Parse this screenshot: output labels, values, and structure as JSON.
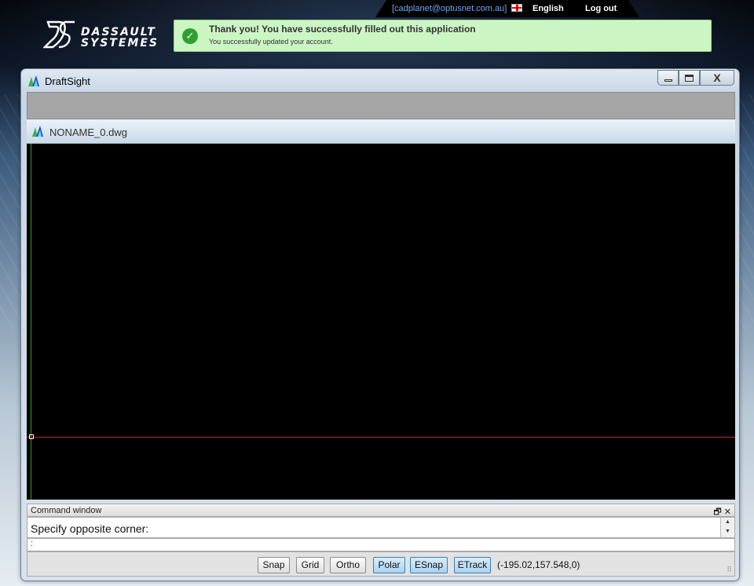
{
  "topbar": {
    "email": "[cadplanet@optusnet.com.au]",
    "language": "English",
    "logout": "Log out"
  },
  "brand": {
    "line1": "DASSAULT",
    "line2": "SYSTEMES"
  },
  "notice": {
    "title": "Thank you! You have successfully filled out this application",
    "subtitle": "You successfully updated your account.",
    "color": "#ccf5c4"
  },
  "window": {
    "title": "DraftSight",
    "close_label": "X"
  },
  "document": {
    "tab_name": "NONAME_0.dwg"
  },
  "command": {
    "header": "Command window",
    "header_icons": "🗗 ✕",
    "output": "Specify opposite corner:",
    "input_prompt": ":"
  },
  "statusbar": {
    "buttons": [
      {
        "label": "Snap",
        "active": false
      },
      {
        "label": "Grid",
        "active": false
      },
      {
        "label": "Ortho",
        "active": false
      },
      {
        "label": "Polar",
        "active": true
      },
      {
        "label": "ESnap",
        "active": true
      },
      {
        "label": "ETrack",
        "active": true
      }
    ],
    "coordinates": "(-195.02,157.548,0)"
  },
  "icons": {
    "app": "draftsight-icon",
    "check": "check-circle-icon",
    "flag": "uk-flag-icon"
  },
  "colors": {
    "canvas": "#000000",
    "y_axis": "#2aa02a",
    "x_axis": "#c0283a",
    "active_button": "#a9d2f2"
  }
}
